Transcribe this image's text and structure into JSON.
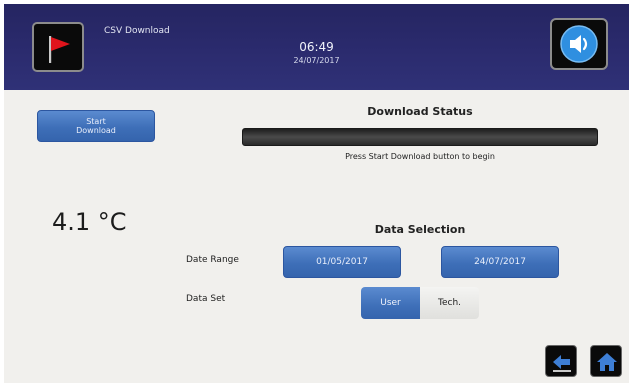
{
  "header": {
    "screen_title": "CSV Download",
    "time": "06:49",
    "date": "24/07/2017",
    "alarm_icon": "red-flag-icon",
    "sound_icon": "speaker-icon"
  },
  "download": {
    "start_button_label": "Start\nDownload",
    "status_title": "Download Status",
    "progress_fraction": 0,
    "status_message": "Press Start Download button to begin"
  },
  "temperature": {
    "value": "4.1 °C"
  },
  "data_selection": {
    "title": "Data Selection",
    "date_range_label": "Date Range",
    "date_from": "01/05/2017",
    "date_to": "24/07/2017",
    "data_set_label": "Data Set",
    "data_set_options": [
      "User",
      "Tech."
    ],
    "data_set_selected": "User"
  },
  "footer": {
    "back_icon": "back-arrow-icon",
    "home_icon": "home-icon"
  },
  "colors": {
    "header_bg": "#2b2b6e",
    "button_blue": "#3e6fb8",
    "panel_bg": "#f1f0ed",
    "alarm_red": "#e0141c",
    "speaker_blue": "#2f8fe0"
  }
}
